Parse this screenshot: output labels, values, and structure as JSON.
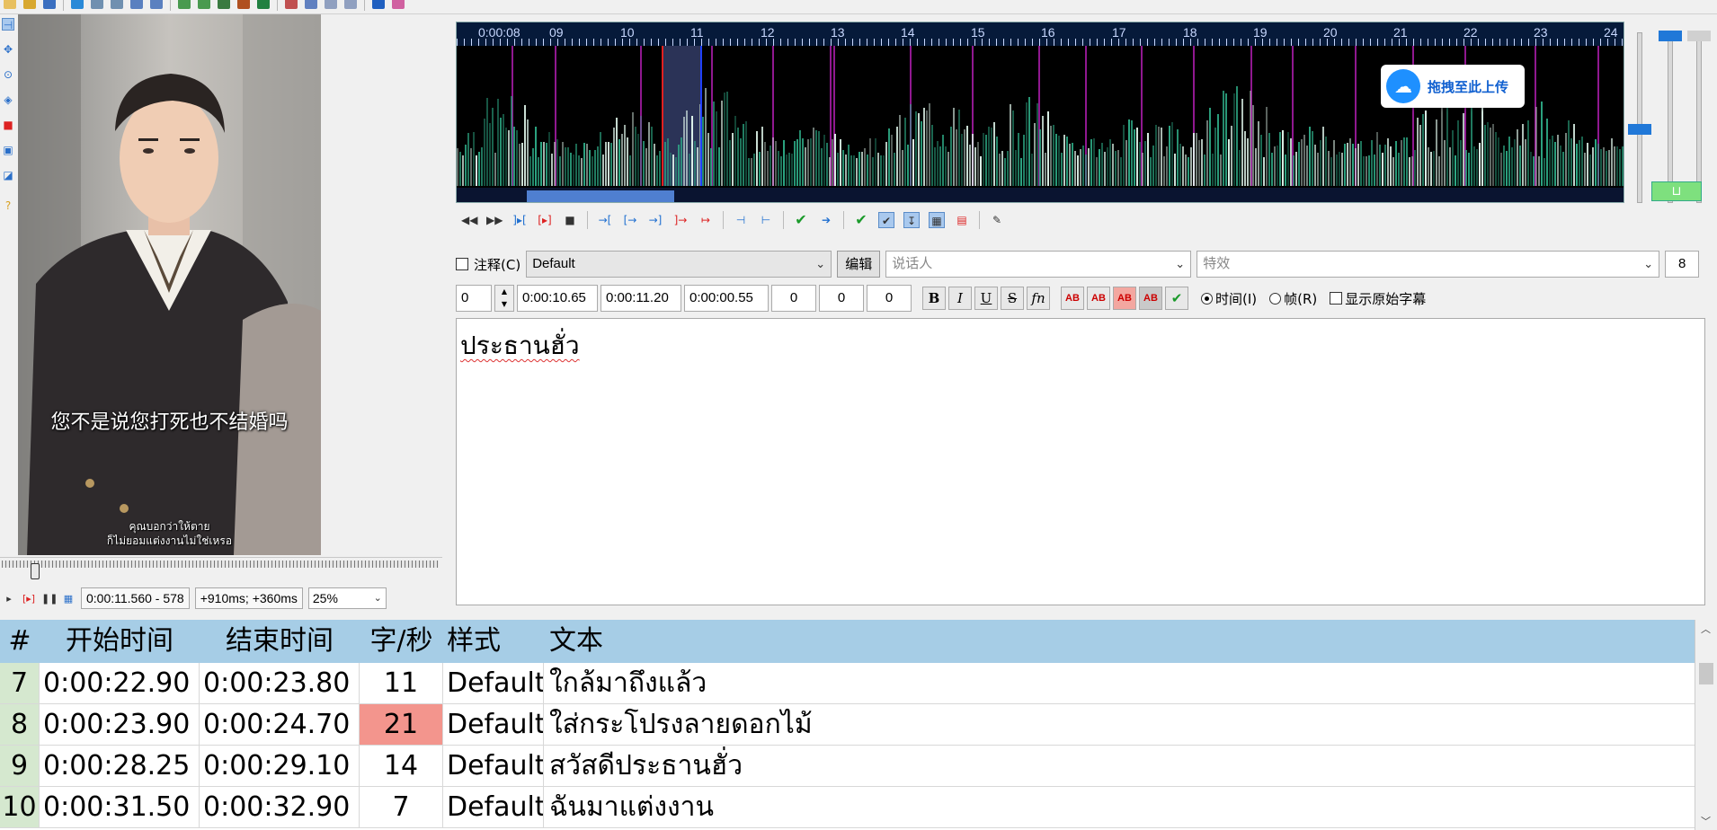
{
  "video": {
    "subtitle_zh": "您不是说您打死也不结婚吗",
    "subtitle_th_line1": "คุณบอกว่าให้ตาย",
    "subtitle_th_line2": "ก็ไม่ยอมแต่งงานไม่ใช่เหรอ",
    "time_display": "0:00:11.560 - 578",
    "offset_display": "+910ms; +360ms",
    "zoom": "25%"
  },
  "audio": {
    "timeline_labels": [
      "0:00:08",
      "09",
      "10",
      "11",
      "12",
      "13",
      "14",
      "15",
      "16",
      "17",
      "18",
      "19",
      "20",
      "21",
      "22",
      "23",
      "24"
    ],
    "upload_badge_text": "拖拽至此上传"
  },
  "edit": {
    "comment_label": "注释(C)",
    "style_value": "Default",
    "edit_button": "编辑",
    "actor_placeholder": "说话人",
    "effect_placeholder": "特效",
    "layer_value": "8",
    "layer_field": "0",
    "start_time": "0:00:10.65",
    "end_time": "0:00:11.20",
    "duration": "0:00:00.55",
    "margin_l": "0",
    "margin_r": "0",
    "margin_v": "0",
    "bold_label": "B",
    "italic_label": "I",
    "underline_label": "U",
    "strike_label": "S",
    "fn_label": "fn",
    "ab_label": "AB",
    "time_radio_label": "时间(I)",
    "frame_radio_label": "帧(R)",
    "show_original_label": "显示原始字幕",
    "text": "ประธานฮั่ว"
  },
  "grid": {
    "headers": [
      "#",
      "开始时间",
      "结束时间",
      "字/秒",
      "样式",
      "文本"
    ],
    "rows": [
      {
        "num": "7",
        "start": "0:00:22.90",
        "end": "0:00:23.80",
        "cps": "11",
        "style": "Default",
        "text": "ใกล้มาถึงแล้ว"
      },
      {
        "num": "8",
        "start": "0:00:23.90",
        "end": "0:00:24.70",
        "cps": "21",
        "style": "Default",
        "text": "ใส่กระโปรงลายดอกไม้"
      },
      {
        "num": "9",
        "start": "0:00:28.25",
        "end": "0:00:29.10",
        "cps": "14",
        "style": "Default",
        "text": "สวัสดีประธานฮั่ว"
      },
      {
        "num": "10",
        "start": "0:00:31.50",
        "end": "0:00:32.90",
        "cps": "7",
        "style": "Default",
        "text": "ฉันมาแต่งงาน"
      }
    ]
  },
  "colors": {
    "grid_header": "#a6cde6",
    "row_number_bg": "#d5e8cf",
    "cps_warning": "#f3958d",
    "spectrogram_bg": "#000000",
    "timeline_bg": "#061a3a"
  }
}
